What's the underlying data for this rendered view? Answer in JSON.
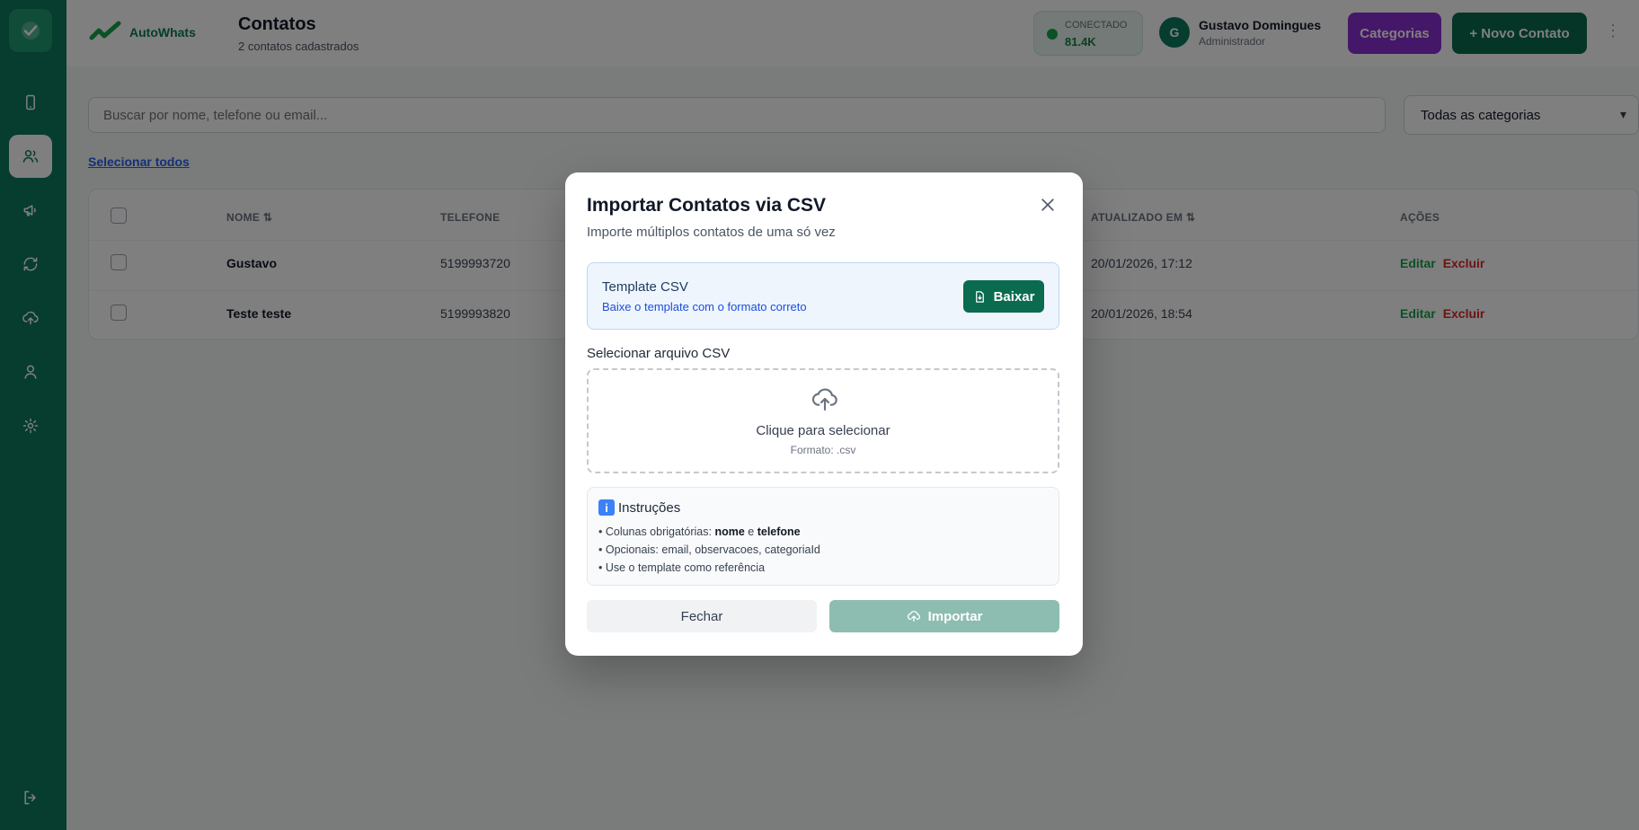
{
  "app": {
    "brand": "AutoWhats"
  },
  "sidebar": {
    "items": [
      {
        "icon": "smartphone-icon",
        "active": false
      },
      {
        "icon": "users-icon",
        "active": true
      },
      {
        "icon": "megaphone-icon",
        "active": false
      },
      {
        "icon": "refresh-icon",
        "active": false
      },
      {
        "icon": "cloud-upload-icon",
        "active": false
      },
      {
        "icon": "user-icon",
        "active": false
      },
      {
        "icon": "gear-icon",
        "active": false
      }
    ],
    "logout_icon": "logout-icon"
  },
  "header": {
    "title": "Contatos",
    "subtitle": "2 contatos cadastrados",
    "status": {
      "label": "CONECTADO",
      "value": "81.4K"
    },
    "user": {
      "initial": "G",
      "name": "Gustavo Domingues",
      "role": "Administrador"
    },
    "categories_button": "Categorias",
    "new_contact_button": "+ Novo Contato",
    "more": "⋮"
  },
  "toolbar": {
    "search_placeholder": "Buscar por nome, telefone ou email...",
    "category_select": "Todas as categorias",
    "select_all": "Selecionar todos"
  },
  "table": {
    "headers": [
      "NOME ⇅",
      "TELEFONE",
      "ATUALIZADO EM ⇅",
      "AÇÕES"
    ],
    "rows": [
      {
        "name": "Gustavo",
        "phone": "5199993720",
        "updated": "20/01/2026, 17:12",
        "edit": "Editar",
        "delete": "Excluir"
      },
      {
        "name": "Teste teste",
        "phone": "5199993820",
        "updated": "20/01/2026, 18:54",
        "edit": "Editar",
        "delete": "Excluir"
      }
    ]
  },
  "modal": {
    "title": "Importar Contatos via CSV",
    "subtitle": "Importe múltiplos contatos de uma só vez",
    "template": {
      "title": "Template CSV",
      "subtitle": "Baixe o template com o formato correto",
      "download_button": "Baixar"
    },
    "file_label": "Selecionar arquivo CSV",
    "dropzone": {
      "title": "Clique para selecionar",
      "subtitle": "Formato: .csv"
    },
    "instructions": {
      "title": "Instruções",
      "line1_prefix": "• Colunas obrigatórias: ",
      "line1_req1": "nome",
      "line1_mid": " e ",
      "line1_req2": "telefone",
      "line2": "• Opcionais: email, observacoes, categoriaId",
      "line3": "• Use o template como referência"
    },
    "close_button": "Fechar",
    "import_button": "Importar"
  },
  "colors": {
    "sidebar": "#0c7a5c",
    "primary": "#0b6b4f",
    "purple": "#8b2fd0",
    "import_disabled": "#8cbdb0"
  }
}
